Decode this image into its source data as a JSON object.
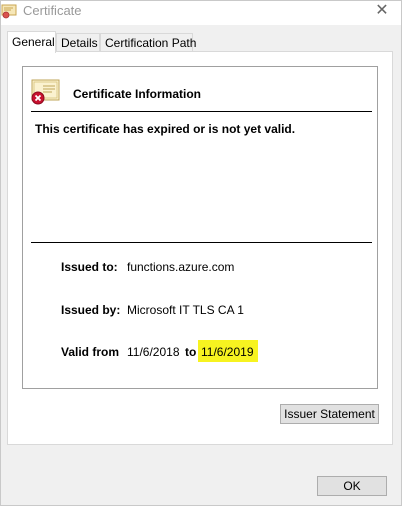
{
  "window": {
    "title": "Certificate",
    "close_glyph": "✕"
  },
  "tabs": [
    {
      "label": "General",
      "active": true
    },
    {
      "label": "Details",
      "active": false
    },
    {
      "label": "Certification Path",
      "active": false
    }
  ],
  "info": {
    "title": "Certificate Information",
    "status": "This certificate has expired or is not yet valid."
  },
  "details": {
    "issued_to_label": "Issued to:",
    "issued_to_value": "functions.azure.com",
    "issued_by_label": "Issued by:",
    "issued_by_value": "Microsoft IT TLS CA 1",
    "valid_from_label": "Valid from",
    "valid_from_value": "11/6/2018",
    "to_label": "to",
    "valid_to_value": "11/6/2019"
  },
  "buttons": {
    "issuer_statement": "Issuer Statement",
    "ok": "OK"
  },
  "colors": {
    "highlight": "#f7f320",
    "error_badge": "#c8102e"
  },
  "icons": {
    "title_icon": "certificate-icon",
    "info_icon": "certificate-error-icon"
  }
}
